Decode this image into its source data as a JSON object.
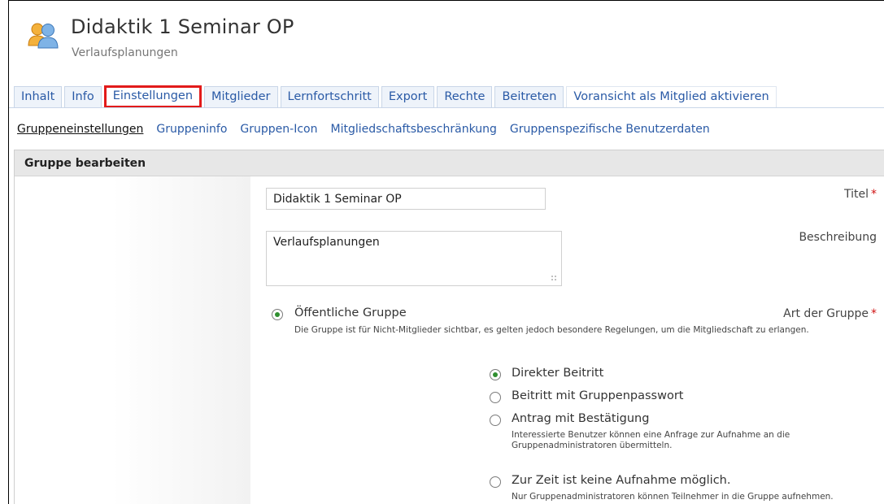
{
  "header": {
    "title": "Didaktik 1 Seminar OP",
    "subtitle": "Verlaufsplanungen",
    "icon": "group-users-icon"
  },
  "tabs": [
    {
      "label": "Inhalt"
    },
    {
      "label": "Info"
    },
    {
      "label": "Einstellungen",
      "active": true
    },
    {
      "label": "Mitglieder"
    },
    {
      "label": "Lernfortschritt"
    },
    {
      "label": "Export"
    },
    {
      "label": "Rechte"
    },
    {
      "label": "Beitreten"
    },
    {
      "label": "Voransicht als Mitglied aktivieren"
    }
  ],
  "subtabs": [
    {
      "label": "Gruppeneinstellungen",
      "current": true
    },
    {
      "label": "Gruppeninfo"
    },
    {
      "label": "Gruppen-Icon"
    },
    {
      "label": "Mitgliedschaftsbeschränkung"
    },
    {
      "label": "Gruppenspezifische Benutzerdaten"
    }
  ],
  "form": {
    "heading": "Gruppe bearbeiten",
    "title_label": "Titel",
    "title_value": "Didaktik 1 Seminar OP",
    "description_label": "Beschreibung",
    "description_value": "Verlaufsplanungen",
    "type_label": "Art der Gruppe",
    "required_mark": "*",
    "public_option": {
      "label": "Öffentliche Gruppe",
      "description": "Die Gruppe ist für Nicht-Mitglieder sichtbar, es gelten jedoch besondere Regelungen, um die Mitgliedschaft zu erlangen.",
      "checked": true
    },
    "join_options": [
      {
        "label": "Direkter Beitritt",
        "checked": true,
        "description": ""
      },
      {
        "label": "Beitritt mit Gruppenpasswort",
        "checked": false,
        "description": ""
      },
      {
        "label": "Antrag mit Bestätigung",
        "checked": false,
        "description": "Interessierte Benutzer können eine Anfrage zur Aufnahme an die Gruppenadministratoren übermitteln."
      },
      {
        "label": "Zur Zeit ist keine Aufnahme möglich.",
        "checked": false,
        "description": "Nur Gruppenadministratoren können Teilnehmer in die Gruppe aufnehmen."
      }
    ]
  },
  "colors": {
    "link": "#2a5aa6",
    "highlight": "#e21a1a",
    "radio_checked": "#2f8f2f",
    "required": "#d01111"
  }
}
